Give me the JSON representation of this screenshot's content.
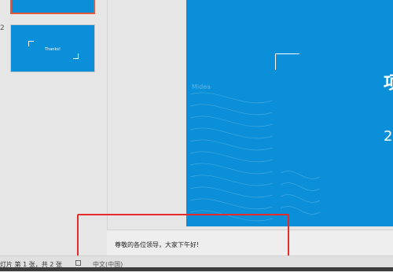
{
  "thumbnails": {
    "slide2_number": "2",
    "slide2_text": "Thanks!"
  },
  "slide": {
    "title_partial": "项",
    "year_partial": "20",
    "logo_text": "Midea"
  },
  "notes": {
    "text": "尊敬的各位领导，大家下午好!"
  },
  "statusbar": {
    "slide_info": "灯片 第 1 张，共 2 张",
    "language": "中文(中国)"
  },
  "colors": {
    "slide_bg": "#0a8fd8",
    "selection_border": "#e0583b",
    "highlight_box": "#e52b2b"
  }
}
